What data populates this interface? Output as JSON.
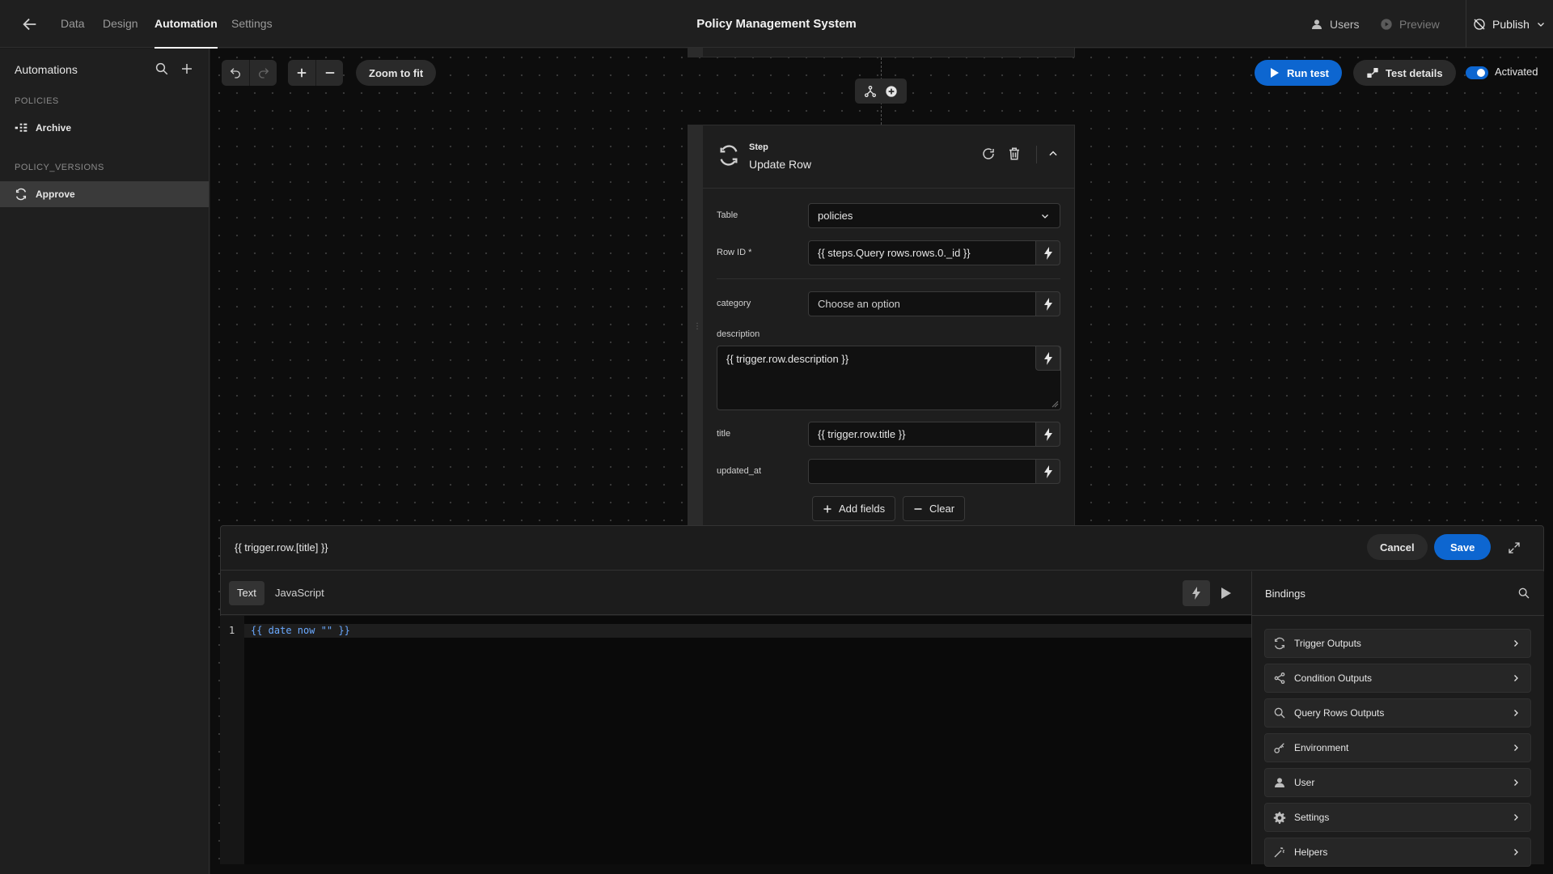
{
  "app": {
    "title": "Policy Management System"
  },
  "nav": {
    "tabs": [
      {
        "label": "Data"
      },
      {
        "label": "Design"
      },
      {
        "label": "Automation"
      },
      {
        "label": "Settings"
      }
    ]
  },
  "topbar": {
    "users_label": "Users",
    "preview_label": "Preview",
    "publish_label": "Publish"
  },
  "sidebar": {
    "title": "Automations",
    "sections": [
      {
        "label": "POLICIES",
        "items": [
          {
            "label": "Archive"
          }
        ]
      },
      {
        "label": "POLICY_VERSIONS",
        "items": [
          {
            "label": "Approve"
          }
        ]
      }
    ]
  },
  "toolbar": {
    "zoom_label": "Zoom to fit"
  },
  "actions": {
    "run_test_label": "Run test",
    "test_details_label": "Test details",
    "activated_label": "Activated"
  },
  "step": {
    "kicker": "Step",
    "title": "Update Row",
    "table": {
      "label": "Table",
      "value": "policies"
    },
    "row_id": {
      "label": "Row ID *",
      "value": "{{ steps.Query rows.rows.0._id }}"
    },
    "fields": [
      {
        "label": "category",
        "value": "Choose an option"
      },
      {
        "label": "description",
        "value": "{{ trigger.row.description }}"
      },
      {
        "label": "title",
        "value": "{{ trigger.row.title }}"
      },
      {
        "label": "updated_at",
        "value": ""
      }
    ],
    "add_fields_label": "Add fields",
    "clear_label": "Clear"
  },
  "editor": {
    "binding_title": "{{ trigger.row.[title] }}",
    "cancel_label": "Cancel",
    "save_label": "Save",
    "tabs": [
      {
        "label": "Text"
      },
      {
        "label": "JavaScript"
      }
    ],
    "line_number": "1",
    "code": "{{ date now \"\" }}"
  },
  "bindings": {
    "title": "Bindings",
    "items": [
      {
        "label": "Trigger Outputs",
        "icon": "sync-icon"
      },
      {
        "label": "Condition Outputs",
        "icon": "share-icon"
      },
      {
        "label": "Query Rows Outputs",
        "icon": "search-icon"
      },
      {
        "label": "Environment",
        "icon": "key-icon"
      },
      {
        "label": "User",
        "icon": "user-icon"
      },
      {
        "label": "Settings",
        "icon": "gear-icon"
      },
      {
        "label": "Helpers",
        "icon": "magic-wand-icon"
      }
    ]
  },
  "colors": {
    "accent": "#0d66d0",
    "canvas": "#0d0d0d",
    "panel": "#1f1f1f",
    "code_text": "#6aa9ff"
  }
}
